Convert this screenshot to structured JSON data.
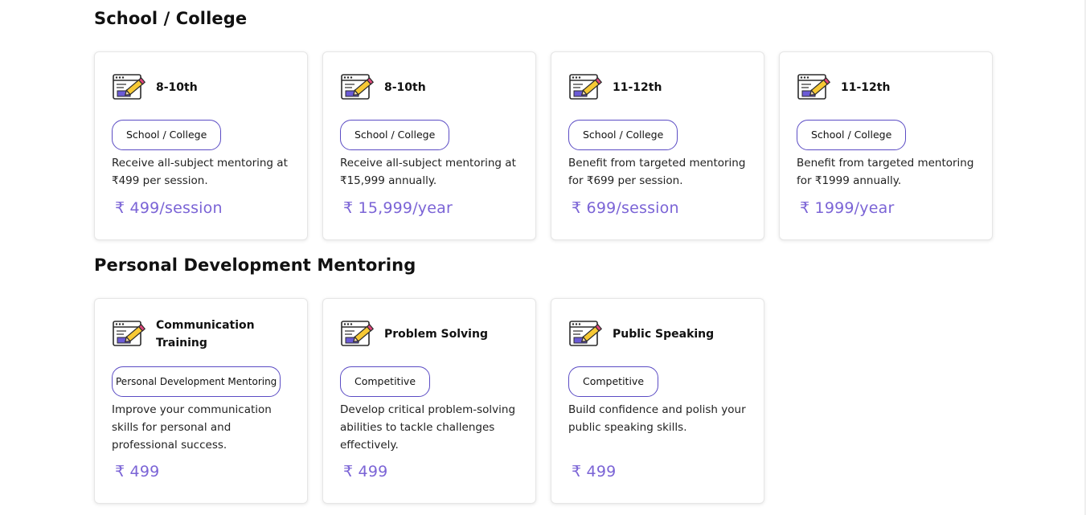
{
  "sections": [
    {
      "title": "School / College",
      "cards": [
        {
          "icon": "code-editor-pencil-icon",
          "title": "8-10th",
          "tag": "School / College",
          "desc": "Receive all-subject mentoring at ₹499 per session.",
          "price": "₹ 499/session"
        },
        {
          "icon": "code-editor-pencil-icon",
          "title": "8-10th",
          "tag": "School / College",
          "desc": "Receive all-subject mentoring at ₹15,999 annually.",
          "price": "₹ 15,999/year"
        },
        {
          "icon": "code-editor-pencil-icon",
          "title": "11-12th",
          "tag": "School / College",
          "desc": "Benefit from targeted mentoring for ₹699 per session.",
          "price": "₹ 699/session"
        },
        {
          "icon": "code-editor-pencil-icon",
          "title": "11-12th",
          "tag": "School / College",
          "desc": "Benefit from targeted mentoring for ₹1999 annually.",
          "price": "₹ 1999/year"
        }
      ]
    },
    {
      "title": "Personal Development Mentoring",
      "cards": [
        {
          "icon": "code-editor-pencil-icon",
          "title": "Communication Training",
          "tag": "Personal Development Mentoring",
          "desc": "Improve your communication skills for personal and professional success.",
          "price": "₹ 499"
        },
        {
          "icon": "code-editor-pencil-icon",
          "title": "Problem Solving",
          "tag": "Competitive",
          "desc": "Develop critical problem-solving abilities to tackle challenges effectively.",
          "price": "₹ 499"
        },
        {
          "icon": "code-editor-pencil-icon",
          "title": "Public Speaking",
          "tag": "Competitive",
          "desc": "Build confidence and polish your public speaking skills.",
          "price": "₹ 499"
        }
      ]
    }
  ],
  "colors": {
    "accent": "#7b64d6",
    "tag_border": "#5b4cc4",
    "card_border": "#e6e6e6"
  }
}
